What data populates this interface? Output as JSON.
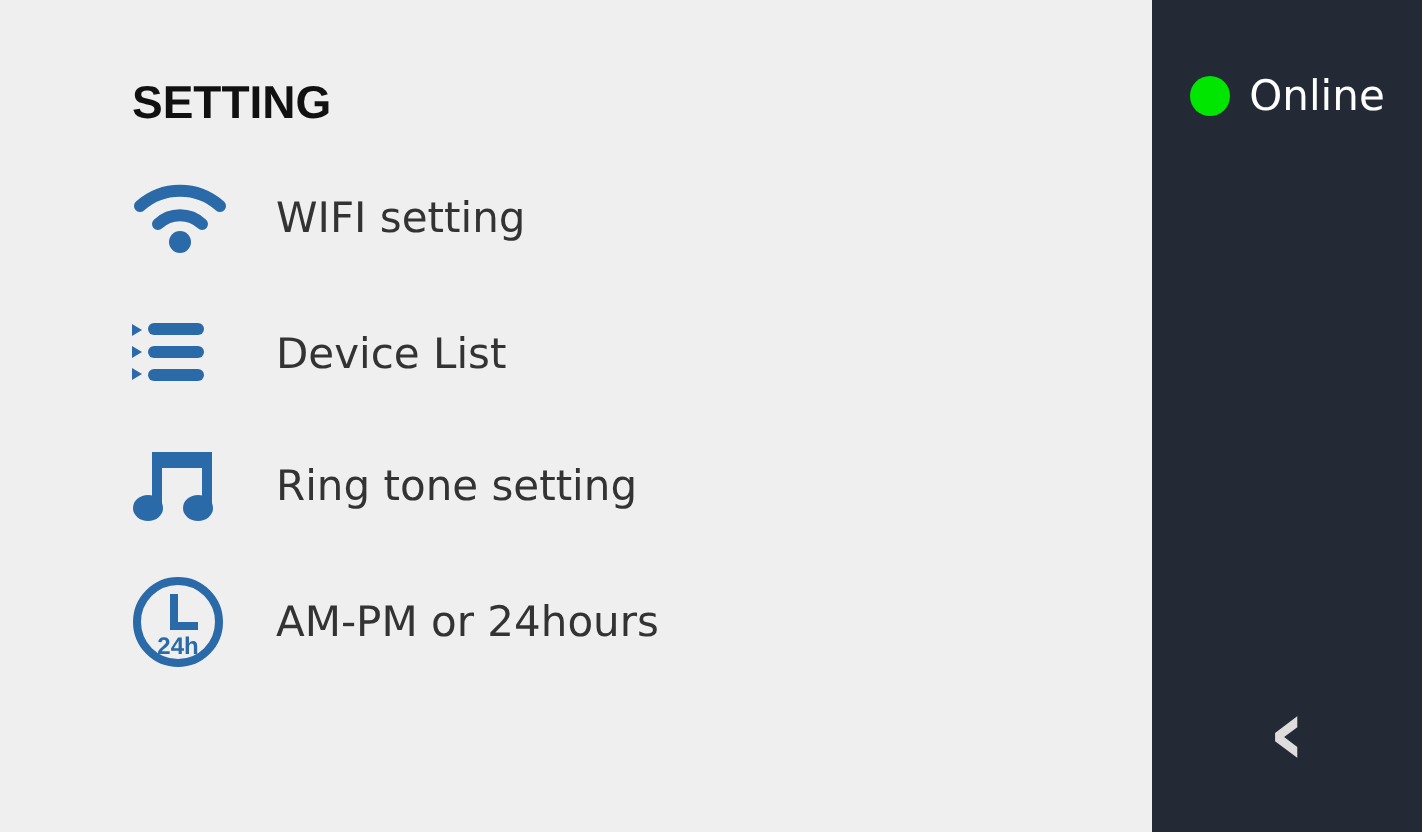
{
  "settings": {
    "title": "SETTING",
    "items": [
      {
        "kind": "wifi",
        "label": "WIFI setting"
      },
      {
        "kind": "list",
        "label": "Device List"
      },
      {
        "kind": "music",
        "label": "Ring tone setting"
      },
      {
        "kind": "clock",
        "label": "AM-PM or 24hours",
        "icon_text": "24h"
      }
    ]
  },
  "side_panel": {
    "status": {
      "label": "Online",
      "color": "#00e600"
    },
    "back": {
      "glyph": "‹"
    }
  }
}
